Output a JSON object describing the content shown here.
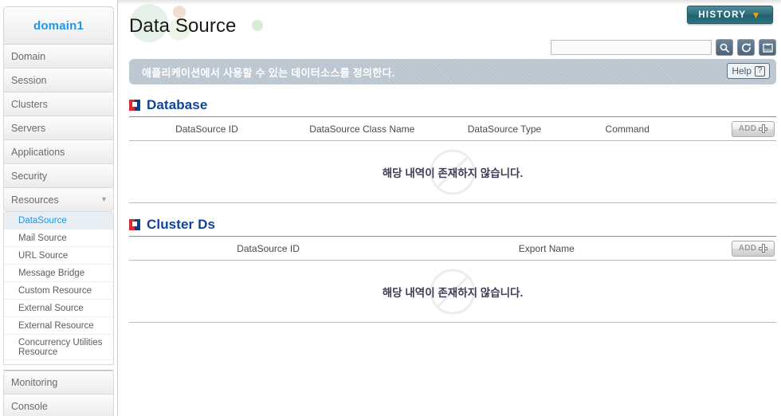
{
  "sidebar": {
    "domain_label": "domain1",
    "items": [
      {
        "label": "Domain"
      },
      {
        "label": "Session"
      },
      {
        "label": "Clusters"
      },
      {
        "label": "Servers"
      },
      {
        "label": "Applications"
      },
      {
        "label": "Security"
      },
      {
        "label": "Resources",
        "expanded": true,
        "chevron": "chevron-down-icon"
      }
    ],
    "sub_items": [
      {
        "label": "DataSource",
        "active": true
      },
      {
        "label": "Mail Source",
        "active": false
      },
      {
        "label": "URL Source",
        "active": false
      },
      {
        "label": "Message Bridge",
        "active": false
      },
      {
        "label": "Custom Resource",
        "active": false
      },
      {
        "label": "External Source",
        "active": false
      },
      {
        "label": "External Resource",
        "active": false
      },
      {
        "label": "Concurrency Utilities Resource",
        "active": false
      }
    ],
    "footer_items": [
      {
        "label": "Monitoring"
      },
      {
        "label": "Console"
      }
    ]
  },
  "header": {
    "title": "Data Source",
    "history_label": "HISTORY",
    "history_chevron": "chevron-down-icon"
  },
  "search": {
    "value": "",
    "placeholder": "",
    "search_icon": "search-icon",
    "refresh_icon": "refresh-icon",
    "xml_export_icon": "xml-export-icon"
  },
  "banner": {
    "message": "애플리케이션에서 사용할 수 있는 데이터소스를 정의한다.",
    "help_label": "Help",
    "help_icon": "question-mark-icon"
  },
  "sections": [
    {
      "id": "database",
      "title": "Database",
      "icon": "four-square-icon",
      "columns": [
        "DataSource ID",
        "DataSource Class Name",
        "DataSource Type",
        "Command"
      ],
      "add_label": "ADD",
      "rows": [],
      "empty_message": "해당 내역이 존재하지 않습니다."
    },
    {
      "id": "cluster-ds",
      "title": "Cluster Ds",
      "icon": "four-square-icon",
      "columns": [
        "DataSource ID",
        "Export Name"
      ],
      "add_label": "ADD",
      "rows": [],
      "empty_message": "해당 내역이 존재하지 않습니다."
    }
  ],
  "colors": {
    "accent_blue": "#11439a",
    "link_blue": "#2196e8",
    "history_teal": "#2f6f7e",
    "history_chevron_orange": "#f0a30a",
    "banner_gray": "#b9c4cf",
    "icon_red": "#d92b36",
    "icon_blue": "#0b3f8c"
  }
}
